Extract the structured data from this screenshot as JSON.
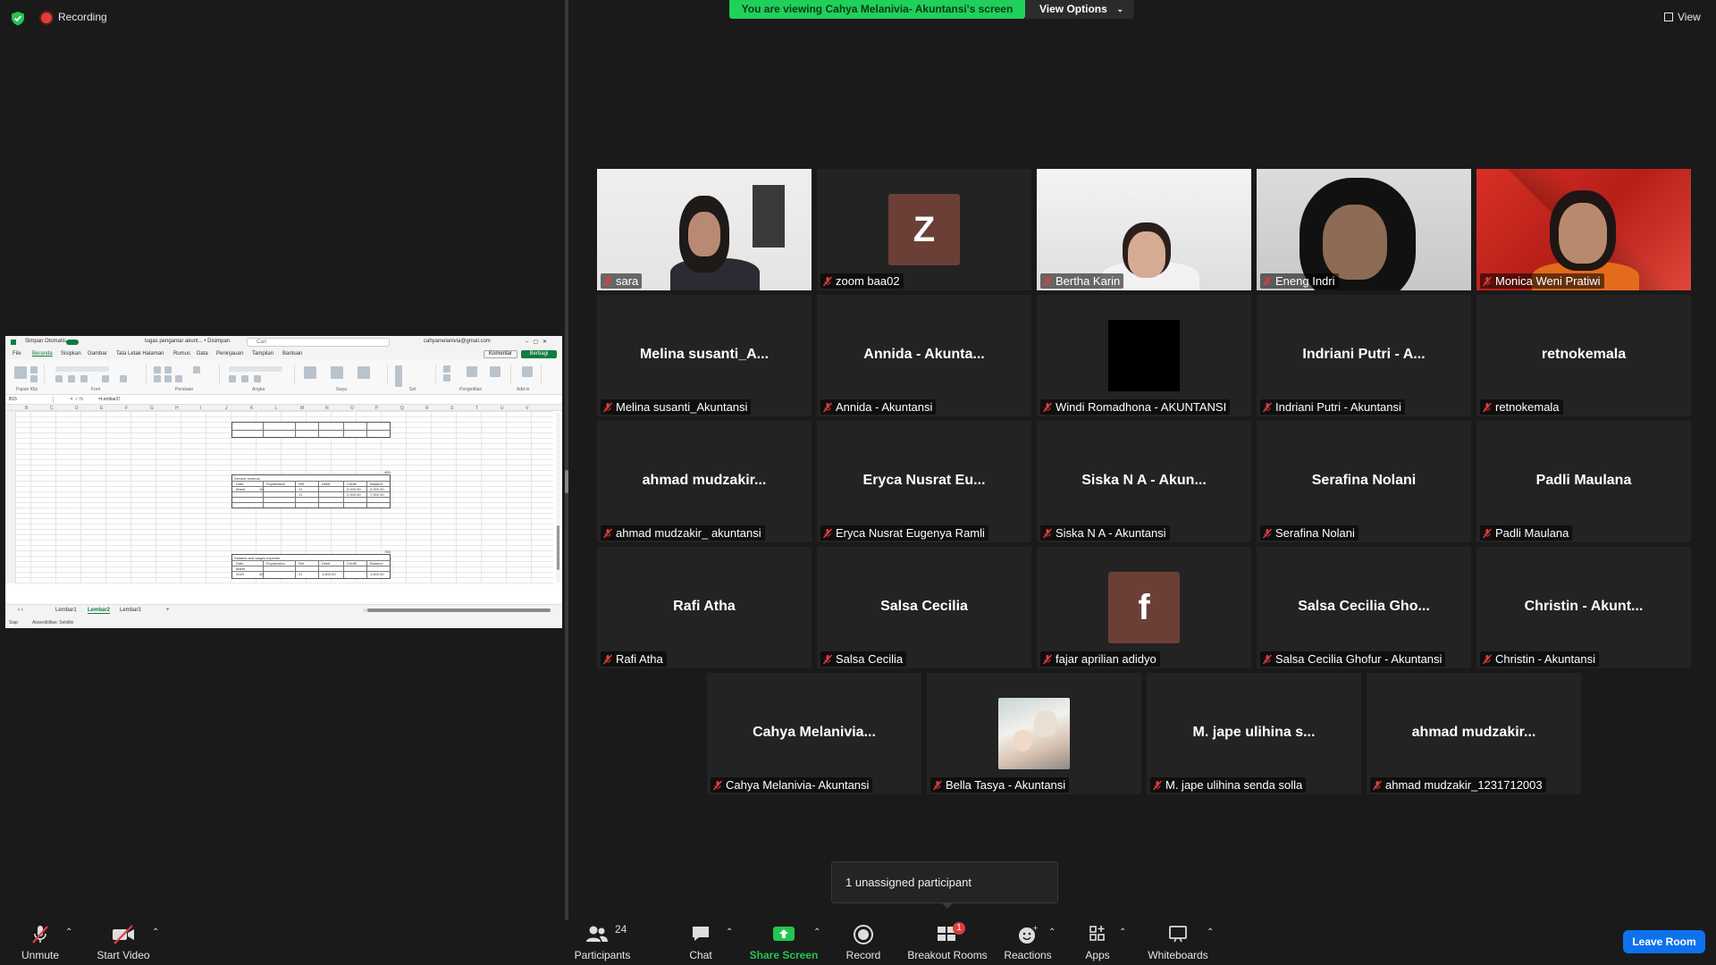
{
  "topbar": {
    "recording_label": "Recording",
    "share_banner": "You are viewing Cahya Melanivia- Akuntansi's screen",
    "view_options": "View Options",
    "view_label": "View"
  },
  "shared_screen": {
    "title_autosave": "Simpan Otomatis",
    "title_doc": "tugas pengantar akunt... • Disimpan",
    "search_placeholder": "Cari",
    "account": "cahyamelanivia@gmail.com",
    "menu": [
      "File",
      "Beranda",
      "Sisipkan",
      "Gambar",
      "Tata Letak Halaman",
      "Rumus",
      "Data",
      "Peninjauan",
      "Tampilan",
      "Bantuan"
    ],
    "comment_btn": "Komentar",
    "share_btn": "Berbagi",
    "ribbon_groups": [
      "Papan Klip",
      "Font",
      "Perataan",
      "Angka",
      "Gaya",
      "Sel",
      "Pengeditan",
      "Add-in"
    ],
    "name_box": "B15",
    "formula": "=Lembar2!",
    "columns": [
      "B",
      "C",
      "D",
      "E",
      "F",
      "G",
      "H",
      "I",
      "J",
      "K",
      "L",
      "M",
      "N",
      "O",
      "P",
      "Q",
      "R",
      "S",
      "T",
      "U",
      "V"
    ],
    "table2_title": "Service revenue",
    "table2_code": "400",
    "table2_headers": [
      "Date",
      "Explanation",
      "Ref",
      "Debit",
      "Credit",
      "Balance"
    ],
    "table2_rows": [
      [
        "Maret",
        "15",
        "J1",
        "",
        "5,000.00",
        "5,000.00"
      ],
      [
        "",
        "",
        "J1",
        "",
        "2,000.00",
        "7,000.00"
      ]
    ],
    "table3_title": "Salaries and wages expense",
    "table3_code": "726",
    "table3_headers": [
      "Date",
      "Explanation",
      "Ref",
      "Debit",
      "Credit",
      "Balance"
    ],
    "table3_rows": [
      [
        "Maret",
        "",
        "",
        "",
        "",
        ""
      ],
      [
        "2023",
        "30",
        "J1",
        "1,600.00",
        "",
        "1,600.00"
      ]
    ],
    "sheet_tabs": [
      "Lembar1",
      "Lembar2",
      "Lembar3"
    ],
    "status_ready": "Siap",
    "status_access": "Aksesibilitas: Selidiki"
  },
  "participants": [
    {
      "name": "sara",
      "kind": "video",
      "video": "sara"
    },
    {
      "name": "zoom baa02",
      "kind": "letter",
      "letter": "Z"
    },
    {
      "name": "Bertha Karin",
      "kind": "video",
      "video": "bertha"
    },
    {
      "name": "Eneng Indri",
      "kind": "video",
      "video": "eneng"
    },
    {
      "name": "Monica Weni Pratiwi",
      "kind": "video",
      "video": "monica",
      "active": true
    },
    {
      "name": "Melina susanti_Akuntansi",
      "kind": "text",
      "display": "Melina  susanti_A..."
    },
    {
      "name": "Annida - Akuntansi",
      "kind": "text",
      "display": "Annida  -  Akunta..."
    },
    {
      "name": "Windi Romadhona - AKUNTANSI",
      "kind": "black"
    },
    {
      "name": "Indriani Putri - Akuntansi",
      "kind": "text",
      "display": "Indriani Putri - A..."
    },
    {
      "name": "retnokemala",
      "kind": "text",
      "display": "retnokemala"
    },
    {
      "name": "ahmad mudzakir_ akuntansi",
      "kind": "text",
      "display": "ahmad  mudzakir..."
    },
    {
      "name": "Eryca Nusrat Eugenya Ramli",
      "kind": "text",
      "display": "Eryca Nusrat Eu..."
    },
    {
      "name": "Siska N A - Akuntansi",
      "kind": "text",
      "display": "Siska N A - Akun..."
    },
    {
      "name": "Serafina Nolani",
      "kind": "text",
      "display": "Serafina Nolani"
    },
    {
      "name": "Padli Maulana",
      "kind": "text",
      "display": "Padli Maulana"
    },
    {
      "name": "Rafi Atha",
      "kind": "text",
      "display": "Rafi Atha"
    },
    {
      "name": "Salsa Cecilia",
      "kind": "text",
      "display": "Salsa Cecilia"
    },
    {
      "name": "fajar aprilian adidyo",
      "kind": "letter",
      "letter": "f"
    },
    {
      "name": "Salsa Cecilia Ghofur - Akuntansi",
      "kind": "text",
      "display": "Salsa Cecilia Gho..."
    },
    {
      "name": "Christin  - Akuntansi",
      "kind": "text",
      "display": "Christin  - Akunt..."
    },
    {
      "name": "Cahya Melanivia- Akuntansi",
      "kind": "text",
      "display": "Cahya  Melanivia..."
    },
    {
      "name": "Bella Tasya - Akuntansi",
      "kind": "photo"
    },
    {
      "name": "M. jape ulihina senda solla",
      "kind": "text",
      "display": "M. jape ulihina s..."
    },
    {
      "name": "ahmad mudzakir_1231712003",
      "kind": "text",
      "display": "ahmad  mudzakir..."
    }
  ],
  "unassigned": "1 unassigned participant",
  "toolbar": {
    "unmute": "Unmute",
    "start_video": "Start Video",
    "participants": "Participants",
    "participants_count": "24",
    "chat": "Chat",
    "share_screen": "Share Screen",
    "record": "Record",
    "breakout_rooms": "Breakout Rooms",
    "breakout_badge": "1",
    "reactions": "Reactions",
    "apps": "Apps",
    "whiteboards": "Whiteboards",
    "leave_room": "Leave Room"
  },
  "colors": {
    "share_banner": "#1fd15a",
    "active_speaker": "#f6e35a",
    "leave": "#0e72ed",
    "share_icon": "#23c552",
    "mute_red": "#e03c3c"
  }
}
